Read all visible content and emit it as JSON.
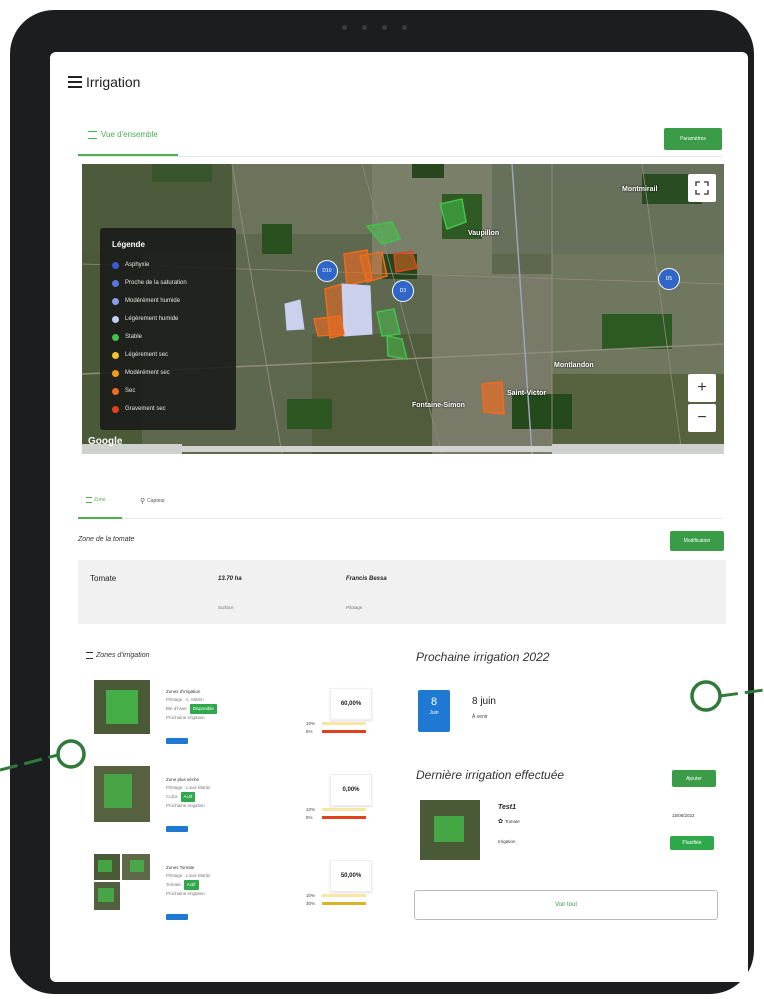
{
  "header": {
    "title": "Irrigation"
  },
  "tabs": {
    "overview_label": "Vue d'ensemble",
    "top_button": "Paramètres"
  },
  "map": {
    "legend_title": "Légende",
    "legend_items": [
      {
        "label": "Asphyxie",
        "color": "#3a5bd9"
      },
      {
        "label": "Proche de la saturation",
        "color": "#5b73e0"
      },
      {
        "label": "Modérément humide",
        "color": "#8a9de8"
      },
      {
        "label": "Légèrement humide",
        "color": "#c5cff5"
      },
      {
        "label": "Stable",
        "color": "#43c24a"
      },
      {
        "label": "Légèrement sec",
        "color": "#f1c232"
      },
      {
        "label": "Modérément sec",
        "color": "#f39c12"
      },
      {
        "label": "Sec",
        "color": "#f26b1d"
      },
      {
        "label": "Gravement sec",
        "color": "#e2421b"
      }
    ],
    "places": [
      "Montmirail",
      "Vaupillon",
      "Montlandon",
      "Fontaine-Simon",
      "Saint-Victor"
    ],
    "badges": [
      "D10",
      "D3",
      "D5"
    ],
    "provider": "Google",
    "zoom_in": "+",
    "zoom_out": "−"
  },
  "subtabs": {
    "zone_label": "Zone",
    "capteur_label": "Capteur"
  },
  "zone": {
    "title": "Zone de la tomate",
    "edit_button": "Modification",
    "crop": "Tomate",
    "area_value": "13.70 ha",
    "area_caption": "Surface",
    "owner_value": "Francis Bessa",
    "owner_caption": "Pilotage"
  },
  "zones_list": {
    "title": "Zones d'irrigation",
    "items": [
      {
        "name": "Zones d'irrigation",
        "line2": "Pilotage : A. Martin",
        "line3": "Blé d'hiver",
        "chip": "Disponible",
        "line4": "Prochaine irrigation",
        "pct": "60,00%",
        "bar1_pct": "10%",
        "bar1_color": "#f6e7a6",
        "bar2_pct": "5%",
        "bar2_color": "#e2421b"
      },
      {
        "name": "Zone plus sèche",
        "line2": "Pilotage : Louis Martin",
        "line3": "Colza",
        "chip": "Actif",
        "line4": "Prochaine irrigation",
        "pct": "0,00%",
        "bar1_pct": "10%",
        "bar1_color": "#f6e7a6",
        "bar2_pct": "5%",
        "bar2_color": "#e2421b"
      },
      {
        "name": "Zones Tomate",
        "line2": "Pilotage : Louis Martin",
        "line3": "Tomate",
        "chip": "Actif",
        "line4": "Prochaine irrigation",
        "pct": "50,00%",
        "bar1_pct": "10%",
        "bar1_color": "#f6e7a6",
        "bar2_pct": "30%",
        "bar2_color": "#d7b52a"
      }
    ]
  },
  "next_irrigation": {
    "title": "Prochaine irrigation 2022",
    "day": "8",
    "month": "Juin",
    "date_text": "8 juin",
    "caption": "À venir"
  },
  "last_irrigation": {
    "title": "Dernière irrigation effectuée",
    "button": "Ajouter",
    "name": "Test1",
    "crop": "Tomate",
    "type": "Irrigation",
    "date": "15/06/2022",
    "status": "Planifiée",
    "see_all": "Voir tout"
  }
}
